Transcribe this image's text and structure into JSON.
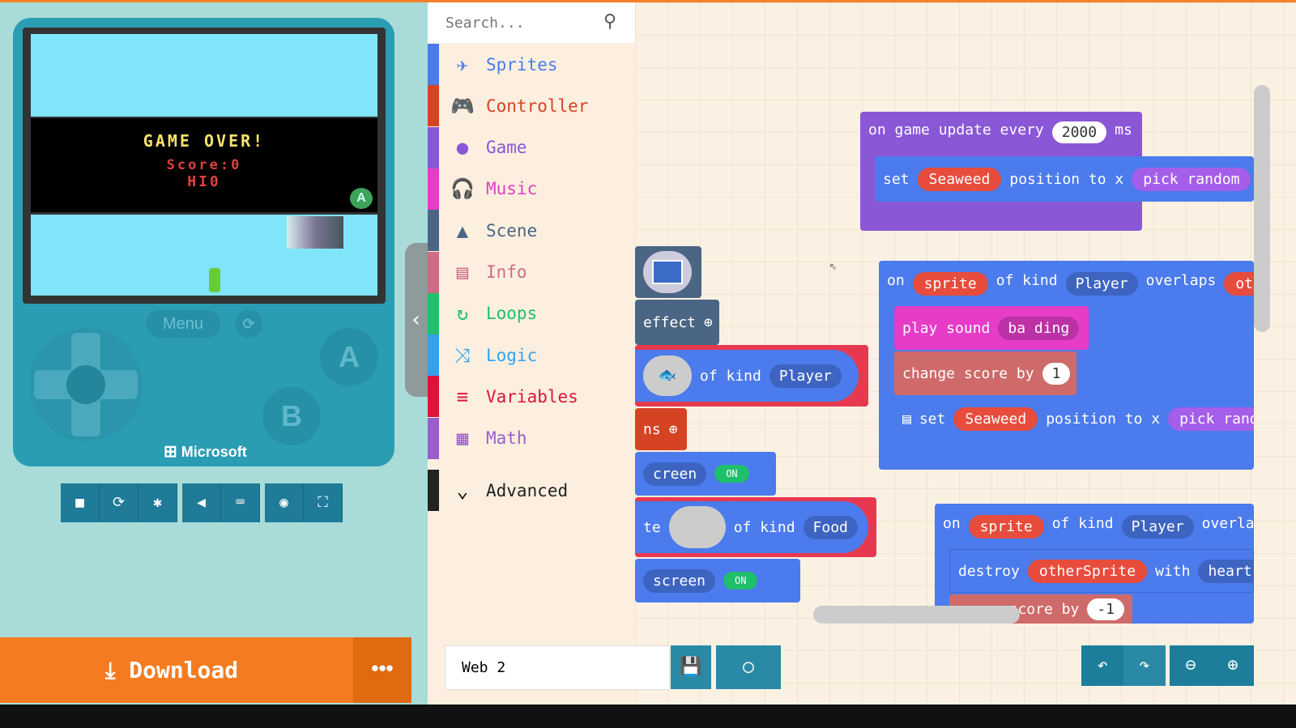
{
  "simulator": {
    "game_over": "GAME OVER!",
    "score": "Score:0",
    "high": "HI0",
    "menu_label": "Menu",
    "a_label": "A",
    "b_label": "B",
    "brand": "Microsoft",
    "toolbar": [
      "stop-icon",
      "restart-icon",
      "debug-icon",
      "mute-icon",
      "keyboard-icon",
      "screenshot-icon",
      "fullscreen-icon"
    ]
  },
  "download": {
    "label": "Download",
    "more": "•••"
  },
  "toolbox": {
    "search_placeholder": "Search...",
    "categories": [
      {
        "label": "Sprites",
        "color": "#4b7bec",
        "icon": "✈"
      },
      {
        "label": "Controller",
        "color": "#d54322",
        "icon": "🎮"
      },
      {
        "label": "Game",
        "color": "#8a57d6",
        "icon": "●"
      },
      {
        "label": "Music",
        "color": "#e63cc8",
        "icon": "🎧"
      },
      {
        "label": "Scene",
        "color": "#4b6584",
        "icon": "▲"
      },
      {
        "label": "Info",
        "color": "#cf6a87",
        "icon": "▤"
      },
      {
        "label": "Loops",
        "color": "#20bf6b",
        "icon": "↻"
      },
      {
        "label": "Logic",
        "color": "#33a3f0",
        "icon": "⤨"
      },
      {
        "label": "Variables",
        "color": "#dc143c",
        "icon": "≡"
      },
      {
        "label": "Math",
        "color": "#9c5ccf",
        "icon": "▦"
      }
    ],
    "advanced": "Advanced"
  },
  "workspace": {
    "update": {
      "on": "on game update every",
      "interval": "2000",
      "ms": "ms",
      "set": "set",
      "sprite": "Seaweed",
      "pos": "position to x",
      "pick": "pick random"
    },
    "overlap1": {
      "on": "on",
      "sprite": "sprite",
      "kind": "of kind",
      "player": "Player",
      "overlaps": "overlaps",
      "other": "oth",
      "play": "play sound",
      "sound": "ba ding",
      "change": "change score by",
      "n": "1",
      "set": "set",
      "seaweed": "Seaweed",
      "pos": "position to x",
      "pick": "pick rand"
    },
    "overlap2": {
      "on": "on",
      "sprite": "sprite",
      "kind": "of kind",
      "player": "Player",
      "overlaps": "overlaps",
      "destroy": "destroy",
      "other": "otherSprite",
      "with": "with",
      "effect": "hearts",
      "score": "score by",
      "n": "-1"
    },
    "left": {
      "effect": "effect",
      "kind1": "of kind",
      "player": "Player",
      "ns": "ns",
      "screen1": "creen",
      "on": "ON",
      "te": "te",
      "kind2": "of kind",
      "food": "Food",
      "screen2": "screen"
    }
  },
  "footer": {
    "project_name": "Web 2"
  }
}
